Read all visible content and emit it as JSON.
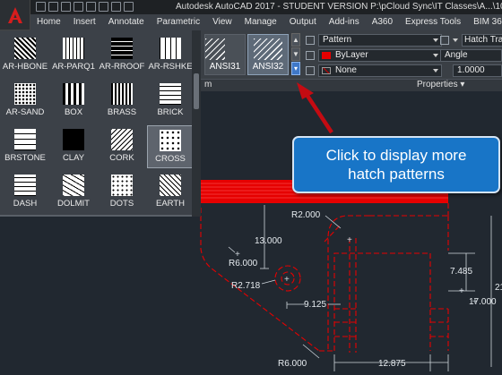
{
  "title_bar": {
    "title": "Autodesk AutoCAD 2017 - STUDENT VERSION    P:\\pCloud Sync\\IT Classes\\A...\\1001.dwg"
  },
  "ribbon_tabs": [
    "Home",
    "Insert",
    "Annotate",
    "Parametric",
    "View",
    "Manage",
    "Output",
    "Add-ins",
    "A360",
    "Express Tools",
    "BIM 360",
    "Featured"
  ],
  "pattern_gallery": [
    {
      "name": "AR-HBONE",
      "icon": "herringbone-pattern"
    },
    {
      "name": "AR-PARQ1",
      "icon": "parquet-pattern"
    },
    {
      "name": "AR-RROOF",
      "icon": "roof-pattern"
    },
    {
      "name": "AR-RSHKE",
      "icon": "shake-pattern"
    },
    {
      "name": "AR-SAND",
      "icon": "sand-pattern"
    },
    {
      "name": "BOX",
      "icon": "box-pattern"
    },
    {
      "name": "BRASS",
      "icon": "brass-pattern"
    },
    {
      "name": "BRICK",
      "icon": "brick-pattern"
    },
    {
      "name": "BRSTONE",
      "icon": "brstone-pattern"
    },
    {
      "name": "CLAY",
      "icon": "clay-pattern"
    },
    {
      "name": "CORK",
      "icon": "cork-pattern"
    },
    {
      "name": "CROSS",
      "icon": "cross-pattern"
    },
    {
      "name": "DASH",
      "icon": "dash-pattern"
    },
    {
      "name": "DOLMIT",
      "icon": "dolmit-pattern"
    },
    {
      "name": "DOTS",
      "icon": "dots-pattern"
    },
    {
      "name": "EARTH",
      "icon": "earth-pattern"
    }
  ],
  "ribbon_gallery": {
    "items": [
      "ANSI31",
      "ANSI32"
    ],
    "selected": "ANSI32"
  },
  "properties": {
    "pattern_label": "Pattern",
    "color_value": "ByLayer",
    "bg_value": "None",
    "hatch_transparency_label": "Hatch Trans",
    "angle_label": "Angle",
    "scale_value": "1.0000",
    "panel_title": "Properties"
  },
  "panel_m_label": "m",
  "callout": {
    "line1": "Click to display more",
    "line2": "hatch patterns"
  },
  "dimensions": {
    "r2000": "R2.000",
    "d13000": "13.000",
    "r6000a": "R6.000",
    "r2718": "R2.718",
    "d9125": "9.125",
    "d7485": "7.485",
    "d17000": "17.000",
    "d21": "21",
    "r6000b": "R6.000",
    "d12875": "12.875"
  },
  "colors": {
    "hatch_red": "#e60000",
    "callout_blue": "#1875c7",
    "arrow_red": "#c40b12"
  }
}
